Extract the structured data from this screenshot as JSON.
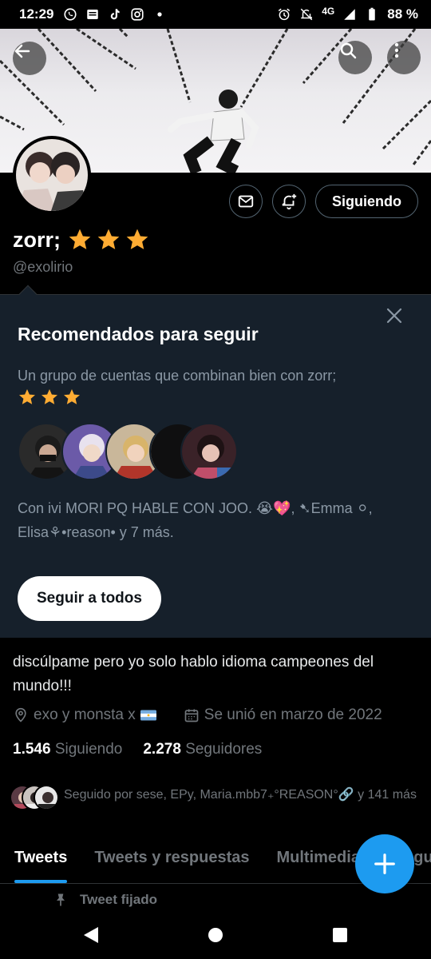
{
  "status_bar": {
    "time": "12:29",
    "network": "4G",
    "battery": "88 %",
    "left_icons": [
      "whatsapp-icon",
      "news-icon",
      "tiktok-icon",
      "instagram-icon",
      "dot-icon"
    ],
    "right_icons": [
      "alarm-icon",
      "mute-icon",
      "signal-icon",
      "battery-icon"
    ]
  },
  "header": {
    "back_icon": "arrow-left-icon",
    "search_icon": "search-icon",
    "more_icon": "more-vertical-icon"
  },
  "profile": {
    "name": "zorr;",
    "stars": 3,
    "handle": "@exolirio",
    "following_button": "Siguiendo",
    "bio": "discúlpame pero yo solo hablo idioma campeones del mundo!!!",
    "location": "exo y monsta x",
    "joined": "Se unió en marzo de 2022",
    "following_count": "1.546",
    "following_label": "Siguiendo",
    "followers_count": "2.278",
    "followers_label": "Seguidores",
    "followed_by": "Seguido por sese, EPy, Maria.mbb7₊°REASON°🔗 y 141 más"
  },
  "recommendations": {
    "title": "Recomendados para seguir",
    "subtitle": "Un grupo de cuentas que combinan bien con zorr;",
    "mutual_text": "Con ivi MORI PQ HABLE CON JOO. 😭💖, ➷Emma ⚪, Elisa⚘•reason• y 7 más.",
    "follow_all_button": "Seguir a todos"
  },
  "tabs": [
    {
      "label": "Tweets",
      "active": true
    },
    {
      "label": "Tweets y respuestas",
      "active": false
    },
    {
      "label": "Multimedia",
      "active": false
    },
    {
      "label": "Me gusta",
      "active": false
    }
  ],
  "pinned_label": "Tweet fijado",
  "colors": {
    "accent": "#1d9bf0",
    "star": "#ffac33",
    "card_bg": "#16202b",
    "muted": "#71767b"
  }
}
